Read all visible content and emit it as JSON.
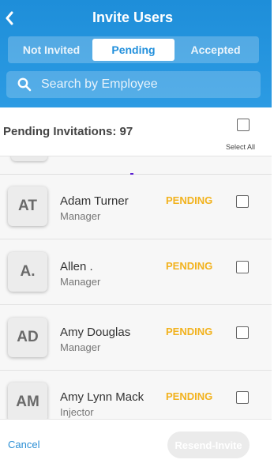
{
  "header": {
    "title": "Invite Users",
    "back_icon": "chevron-left-icon"
  },
  "tabs": [
    {
      "label": "Not Invited",
      "active": false
    },
    {
      "label": "Pending",
      "active": true
    },
    {
      "label": "Accepted",
      "active": false
    }
  ],
  "search": {
    "placeholder": "Search by Employee",
    "value": "",
    "icon": "search-icon"
  },
  "summary": {
    "label": "Pending Invitations:",
    "count": "97",
    "select_all_label": "Select All",
    "select_all_checked": false
  },
  "employees": [
    {
      "initials": "AT",
      "name": "Adam Turner",
      "role": "Manager",
      "status": "PENDING",
      "checked": false
    },
    {
      "initials": "A.",
      "name": "Allen .",
      "role": "Manager",
      "status": "PENDING",
      "checked": false
    },
    {
      "initials": "AD",
      "name": "Amy Douglas",
      "role": "Manager",
      "status": "PENDING",
      "checked": false
    },
    {
      "initials": "AM",
      "name": "Amy Lynn Mack",
      "role": "Injector",
      "status": "PENDING",
      "checked": false
    }
  ],
  "footer": {
    "cancel_label": "Cancel",
    "resend_label": "Resend-Invite",
    "resend_enabled": false
  },
  "colors": {
    "header": "#2290dc",
    "status_pending": "#f2b21d",
    "link": "#2a8ed4"
  }
}
